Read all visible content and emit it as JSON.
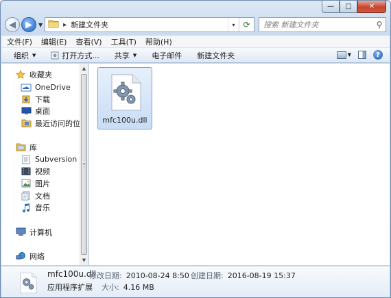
{
  "window": {
    "caption_buttons": {
      "minimize": "—",
      "maximize": "□",
      "close": "✕"
    }
  },
  "address_bar": {
    "path_separator": "▸",
    "location": "新建文件夹",
    "dropdown": "▾",
    "refresh": "⟳"
  },
  "search": {
    "placeholder": "搜索 新建文件夹",
    "icon": "search-icon"
  },
  "menubar": {
    "items": [
      "文件(F)",
      "编辑(E)",
      "查看(V)",
      "工具(T)",
      "帮助(H)"
    ]
  },
  "commandbar": {
    "organize": "组织",
    "open_with": "打开方式...",
    "share": "共享",
    "email": "电子邮件",
    "new_folder": "新建文件夹",
    "dropdown_arrow": "▼",
    "help": "?"
  },
  "navpane": {
    "favorites": {
      "label": "收藏夹",
      "icon": "star-icon"
    },
    "favorite_items": [
      {
        "label": "OneDrive",
        "icon": "onedrive-icon"
      },
      {
        "label": "下载",
        "icon": "downloads-icon"
      },
      {
        "label": "桌面",
        "icon": "desktop-icon"
      },
      {
        "label": "最近访问的位置",
        "icon": "recent-places-icon"
      }
    ],
    "libraries": {
      "label": "库",
      "icon": "library-icon"
    },
    "library_items": [
      {
        "label": "Subversion",
        "icon": "subversion-icon"
      },
      {
        "label": "视频",
        "icon": "videos-icon"
      },
      {
        "label": "图片",
        "icon": "pictures-icon"
      },
      {
        "label": "文档",
        "icon": "documents-icon"
      },
      {
        "label": "音乐",
        "icon": "music-icon"
      }
    ],
    "computer": {
      "label": "计算机",
      "icon": "computer-icon"
    },
    "network": {
      "label": "网络",
      "icon": "network-icon"
    }
  },
  "content": {
    "files": [
      {
        "name": "mfc100u.dll",
        "icon": "dll-gear-icon"
      }
    ]
  },
  "details": {
    "file_name": "mfc100u.dll",
    "file_type": "应用程序扩展",
    "modified_label": "修改日期:",
    "modified_value": "2010-08-24 8:50",
    "created_label": "创建日期:",
    "created_value": "2016-08-19 15:37",
    "size_label": "大小:",
    "size_value": "4.16 MB"
  },
  "colors": {
    "selection_border": "#7da2ce",
    "selection_fill": "#c9ddf5",
    "window_frame": "#c7d9ef"
  }
}
